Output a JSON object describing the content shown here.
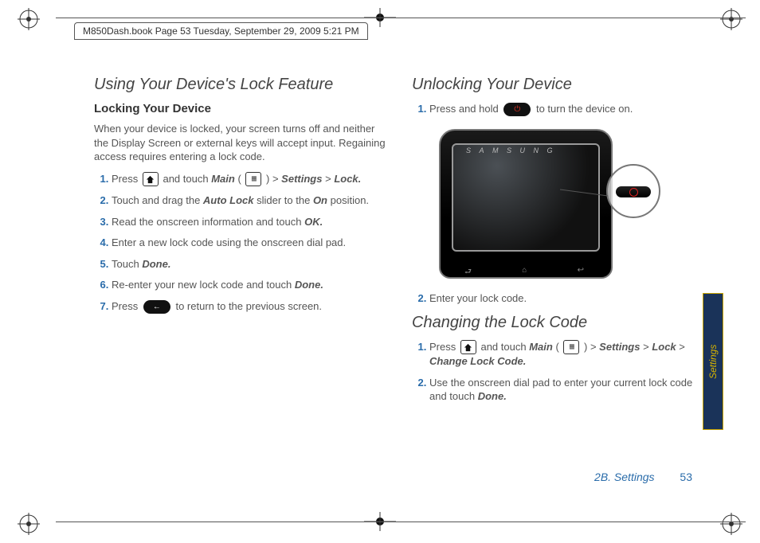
{
  "meta_bar": "M850Dash.book  Page 53  Tuesday, September 29, 2009  5:21 PM",
  "left": {
    "h2": "Using Your Device's Lock Feature",
    "h3": "Locking Your Device",
    "intro": "When your device is locked, your screen turns off and neither the Display Screen or external keys will accept input. Regaining access requires entering a lock code.",
    "steps": {
      "s1a": "Press ",
      "s1b": " and touch ",
      "s1_main": "Main",
      "s1c": " ( ",
      "s1d": " ) > ",
      "s1_sett": "Settings",
      "s1e": " > ",
      "s1_lock": "Lock.",
      "s2a": "Touch and drag the ",
      "s2_auto": "Auto Lock",
      "s2b": " slider to the ",
      "s2_on": "On",
      "s2c": " position.",
      "s3a": "Read the onscreen information and touch ",
      "s3_ok": "OK.",
      "s4": "Enter a new lock code using the onscreen dial pad.",
      "s5a": "Touch ",
      "s5_done": "Done.",
      "s6a": "Re-enter your new lock code and touch ",
      "s6_done": "Done.",
      "s7a": "Press ",
      "s7b": " to return to the previous screen."
    }
  },
  "right": {
    "h2a": "Unlocking Your Device",
    "a": {
      "s1a": "Press and hold ",
      "s1b": " to turn the device on.",
      "s2": "Enter your lock code."
    },
    "h2b": "Changing the Lock Code",
    "b": {
      "s1a": "Press ",
      "s1b": " and touch ",
      "s1_main": "Main",
      "s1c": " ( ",
      "s1d": " ) > ",
      "s1_sett": "Settings",
      "s1e": " > ",
      "s1_lock": "Lock",
      "s1f": " > ",
      "s1_ch": "Change Lock Code.",
      "s2a": "Use the onscreen dial pad to enter your current lock code and touch ",
      "s2_done": "Done."
    }
  },
  "footer_section": "2B. Settings",
  "footer_page": "53",
  "side_tab": "Settings"
}
